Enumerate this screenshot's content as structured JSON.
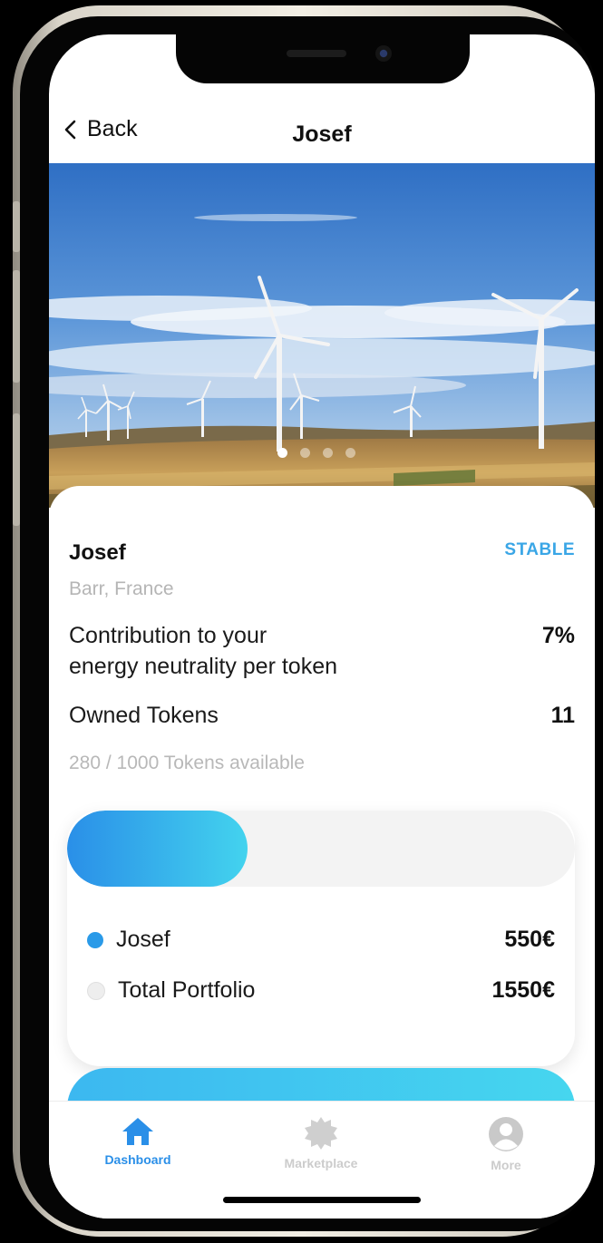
{
  "nav": {
    "back_label": "Back",
    "title": "Josef"
  },
  "carousel": {
    "page_count": 4,
    "active_index": 0
  },
  "detail": {
    "name": "Josef",
    "status": "STABLE",
    "location": "Barr, France",
    "contribution_label_line1": "Contribution to your",
    "contribution_label_line2": "energy neutrality per token",
    "contribution_value": "7%",
    "owned_label": "Owned Tokens",
    "owned_value": "11",
    "availability": "280 / 1000 Tokens available"
  },
  "portfolio": {
    "share_fraction": 0.3548,
    "items": [
      {
        "label": "Josef",
        "value": "550€",
        "dot_color": "#2a9ae8"
      },
      {
        "label": "Total Portfolio",
        "value": "1550€",
        "dot_color": "#eeeeee"
      }
    ]
  },
  "tabbar": {
    "tabs": [
      {
        "label": "Dashboard",
        "icon": "home-icon",
        "active": true
      },
      {
        "label": "Marketplace",
        "icon": "gear-badge-icon",
        "active": false
      },
      {
        "label": "More",
        "icon": "user-icon",
        "active": false
      }
    ]
  },
  "colors": {
    "accent": "#3aa6e6",
    "active_tab": "#2a8fe8",
    "inactive_tab": "#c9c9c9"
  }
}
